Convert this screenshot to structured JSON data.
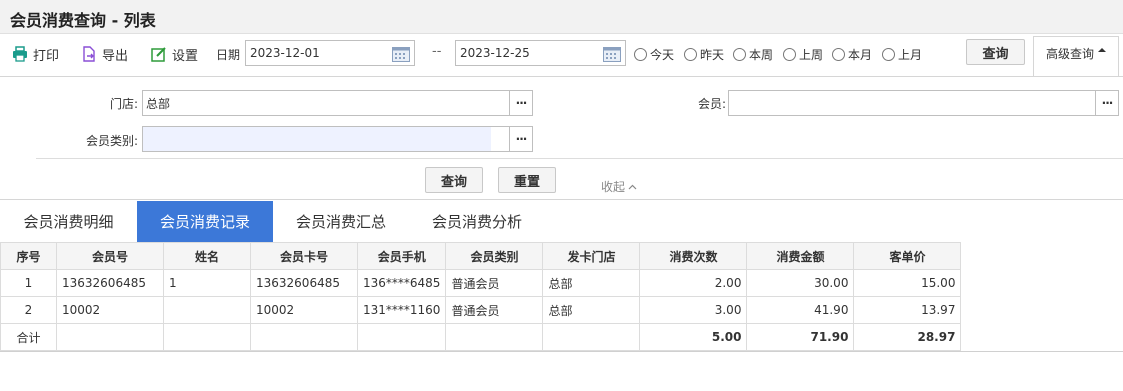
{
  "window": {
    "title": "会员消费查询 - 列表"
  },
  "toolbar": {
    "print_label": "打印",
    "export_label": "导出",
    "settings_label": "设置",
    "date_label": "日期",
    "date_from": "2023-12-01",
    "date_to": "2023-12-25",
    "date_separator": "--",
    "radios": [
      "今天",
      "昨天",
      "本周",
      "上周",
      "本月",
      "上月"
    ],
    "query_label": "查询",
    "advanced_label": "高级查询"
  },
  "filters": {
    "store_label": "门店:",
    "store_value": "总部",
    "member_label": "会员:",
    "member_value": "",
    "member_type_label": "会员类别:",
    "member_type_value": "",
    "more_label": "···",
    "query_label": "查询",
    "reset_label": "重置",
    "collapse_label": "收起"
  },
  "tabs": [
    "会员消费明细",
    "会员消费记录",
    "会员消费汇总",
    "会员消费分析"
  ],
  "active_tab": 1,
  "table": {
    "headers": [
      "序号",
      "会员号",
      "姓名",
      "会员卡号",
      "会员手机",
      "会员类别",
      "发卡门店",
      "消费次数",
      "消费金额",
      "客单价"
    ],
    "rows": [
      [
        "1",
        "13632606485",
        "1",
        "13632606485",
        "136****6485",
        "普通会员",
        "总部",
        "2.00",
        "30.00",
        "15.00"
      ],
      [
        "2",
        "10002",
        "",
        "10002",
        "131****1160",
        "普通会员",
        "总部",
        "3.00",
        "41.90",
        "13.97"
      ]
    ],
    "total": [
      "合计",
      "",
      "",
      "",
      "",
      "",
      "",
      "5.00",
      "71.90",
      "28.97"
    ]
  },
  "colors": {
    "accent": "#3c78d8",
    "icon_teal": "#1a9c8c",
    "icon_purple": "#8a4fd6",
    "icon_green": "#2e9b3a"
  }
}
